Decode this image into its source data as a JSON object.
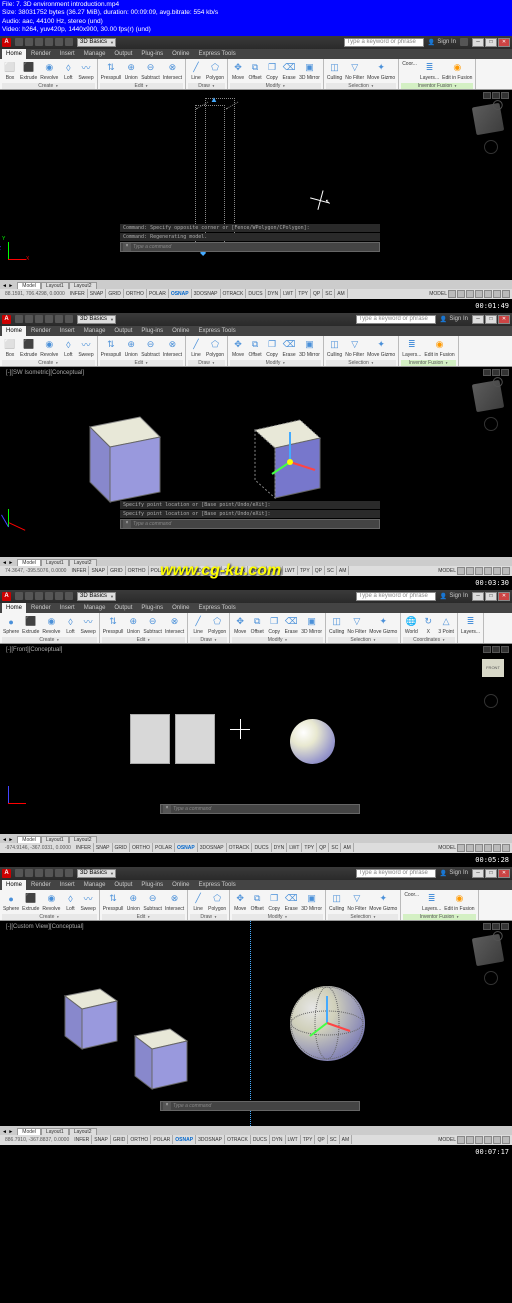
{
  "info": {
    "file": "File: 7. 3D environment introduction.mp4",
    "size": "Size: 38031752 bytes (36.27 MiB), duration: 00:09:09, avg.bitrate: 554 kb/s",
    "audio": "Audio: aac, 44100 Hz, stereo (und)",
    "video": "Video: h264, yuv420p, 1440x900, 30.00 fps(r) (und)"
  },
  "workspace": "3D Basics",
  "search_placeholder": "Type a keyword or phrase",
  "signin": "Sign In",
  "menu": {
    "home": "Home",
    "render": "Render",
    "insert": "Insert",
    "manage": "Manage",
    "output": "Output",
    "plugins": "Plug-ins",
    "online": "Online",
    "express": "Express Tools"
  },
  "ribbon": {
    "box": "Box",
    "extrude": "Extrude",
    "revolve": "Revolve",
    "loft": "Loft",
    "sweep": "Sweep",
    "sphere": "Sphere",
    "presspull": "Presspull",
    "union": "Union",
    "subtract": "Subtract",
    "intersect": "Intersect",
    "line": "Line",
    "polygon": "Polygon",
    "move": "Move",
    "offset": "Offset",
    "copy": "Copy",
    "erase": "Erase",
    "mirror": "3D Mirror",
    "culling": "Culling",
    "nofilter": "No Filter",
    "gizmo": "Move Gizmo",
    "world": "World",
    "x": "X",
    "point3": "3 Point",
    "coor": "Coor...",
    "layers": "Layers...",
    "fusion": "Edit in Fusion",
    "p_create": "Create",
    "p_edit": "Edit",
    "p_draw": "Draw",
    "p_modify": "Modify",
    "p_selection": "Selection",
    "p_coord": "Coordinates",
    "p_inventor": "Inventor Fusion"
  },
  "cmd1": {
    "l1": "Command: Specify opposite corner or [Fence/WPolygon/CPolygon]:",
    "l2": "Command: Regenerating model.",
    "prompt": "Type a command"
  },
  "cmd2": {
    "l1": "Specify point location or [Base point/Undo/eXit]:",
    "l2": "Specify point location or [Base point/Undo/eXit]:"
  },
  "layout": {
    "model": "Model",
    "l1": "Layout1",
    "l2": "Layout2"
  },
  "status": {
    "c1": "88.1591, 706.4298, 0.0000",
    "c2": "74.3647, -395.5076, 0.0000",
    "c3": "-974.9146, -367.0331, 0.0000",
    "c4": "886.7910, -367.8837, 0.0000",
    "infer": "INFER",
    "snap": "SNAP",
    "grid": "GRID",
    "ortho": "ORTHO",
    "polar": "POLAR",
    "osnap": "OSNAP",
    "3dosnap": "3DOSNAP",
    "otrack": "OTRACK",
    "ducs": "DUCS",
    "dyn": "DYN",
    "lwt": "LWT",
    "tpy": "TPY",
    "qp": "QP",
    "sc": "SC",
    "am": "AM",
    "model": "MODEL"
  },
  "view": {
    "sw": "[-][SW Isometric][Conceptual]",
    "front": "[-][Front][Conceptual]",
    "custom": "[-][Custom View][Conceptual]",
    "frontcube": "FRONT"
  },
  "ts": {
    "t1": "00:01:49",
    "t2": "00:03:30",
    "t3": "00:05:28",
    "t4": "00:07:17"
  },
  "watermark": "www.cg-ku.com"
}
